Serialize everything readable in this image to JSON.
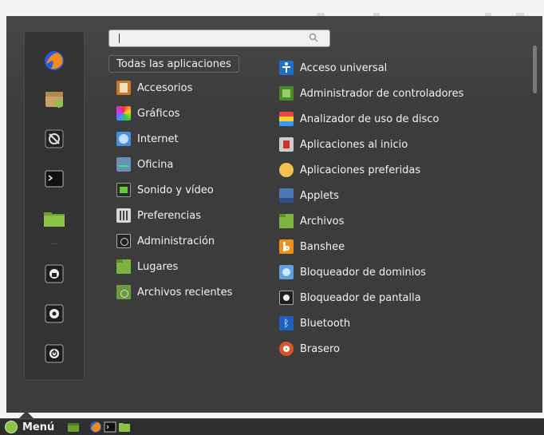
{
  "search": {
    "placeholder": ""
  },
  "all_apps_label": "Todas las aplicaciones",
  "categories": [
    {
      "label": "Accesorios",
      "icon": "accessories-icon"
    },
    {
      "label": "Gráficos",
      "icon": "graphics-icon"
    },
    {
      "label": "Internet",
      "icon": "internet-icon"
    },
    {
      "label": "Oficina",
      "icon": "office-icon"
    },
    {
      "label": "Sonido y vídeo",
      "icon": "multimedia-icon"
    },
    {
      "label": "Preferencias",
      "icon": "preferences-icon"
    },
    {
      "label": "Administración",
      "icon": "administration-icon"
    },
    {
      "label": "Lugares",
      "icon": "places-folder-icon"
    },
    {
      "label": "Archivos recientes",
      "icon": "recent-files-icon"
    }
  ],
  "apps": [
    {
      "label": "Acceso universal",
      "icon": "accessibility-icon"
    },
    {
      "label": "Administrador de controladores",
      "icon": "driver-manager-icon"
    },
    {
      "label": "Analizador de uso de disco",
      "icon": "disk-usage-icon"
    },
    {
      "label": "Aplicaciones al inicio",
      "icon": "startup-apps-icon"
    },
    {
      "label": "Aplicaciones preferidas",
      "icon": "preferred-apps-icon"
    },
    {
      "label": "Applets",
      "icon": "applets-icon"
    },
    {
      "label": "Archivos",
      "icon": "files-folder-icon"
    },
    {
      "label": "Banshee",
      "icon": "banshee-icon"
    },
    {
      "label": "Bloqueador de dominios",
      "icon": "domain-blocker-icon"
    },
    {
      "label": "Bloqueador de pantalla",
      "icon": "screen-locker-icon"
    },
    {
      "label": "Bluetooth",
      "icon": "bluetooth-icon"
    },
    {
      "label": "Brasero",
      "icon": "brasero-icon"
    }
  ],
  "favorites": [
    "firefox-icon",
    "software-manager-icon",
    "system-settings-icon",
    "terminal-icon",
    "files-icon",
    "lock-screen-icon",
    "logout-icon",
    "shutdown-icon"
  ],
  "panel": {
    "menu_label": "Menú"
  },
  "colors": {
    "menu_bg": "#3c3c3c",
    "panel_bg": "#2e2e2e",
    "mint_green": "#8bc34a",
    "text": "#f2f2f2"
  }
}
